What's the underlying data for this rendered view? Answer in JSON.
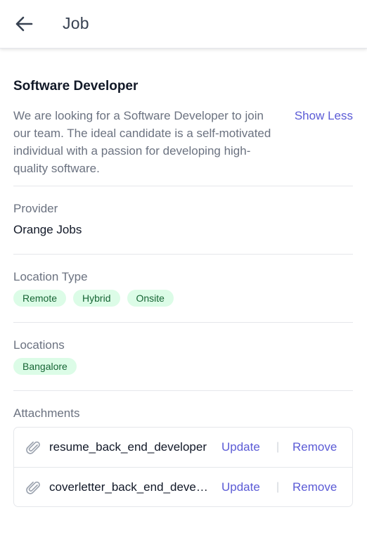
{
  "appbar": {
    "title": "Job",
    "back_icon": "arrow-left-icon"
  },
  "job": {
    "title": "Software Developer",
    "description": "We are looking for a Software Developer to join our team. The ideal candidate is a self-motivated individual with a passion for developing high-quality software.",
    "toggle_label": "Show Less"
  },
  "provider": {
    "label": "Provider",
    "value": "Orange Jobs"
  },
  "location_type": {
    "label": "Location Type",
    "chips": [
      "Remote",
      "Hybrid",
      "Onsite"
    ]
  },
  "locations": {
    "label": "Locations",
    "chips": [
      "Bangalore"
    ]
  },
  "attachments": {
    "label": "Attachments",
    "items": [
      {
        "name": "resume_back_end_developer",
        "update_label": "Update",
        "remove_label": "Remove",
        "icon": "paperclip-icon"
      },
      {
        "name": "coverletter_back_end_developer",
        "update_label": "Update",
        "remove_label": "Remove",
        "icon": "paperclip-icon"
      }
    ],
    "separator": "|"
  },
  "colors": {
    "accent": "#5b5bd6",
    "chip_bg": "#dcfce7",
    "chip_text": "#166534",
    "muted_text": "#6b7280"
  }
}
